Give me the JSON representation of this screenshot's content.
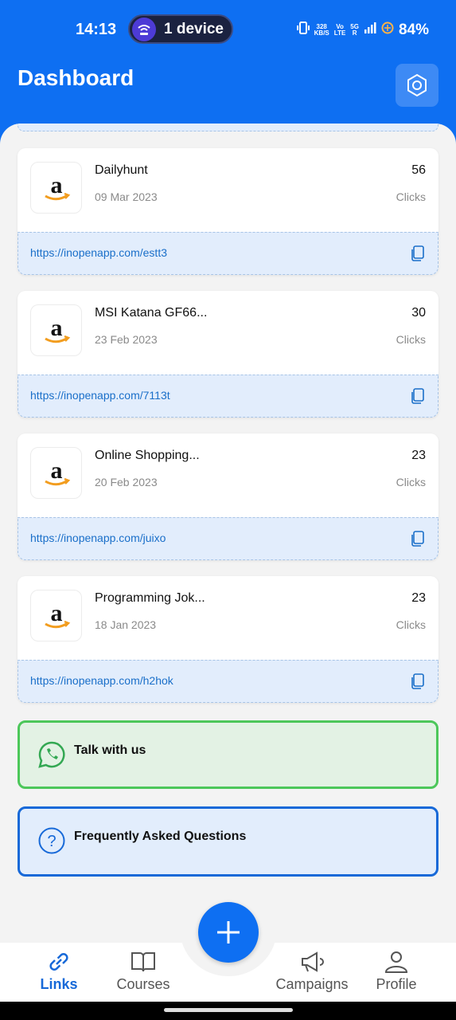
{
  "status": {
    "time": "14:13",
    "pill": "1 device",
    "speed": [
      "328",
      "KB/S"
    ],
    "volte": [
      "Vo",
      "LTE"
    ],
    "net": [
      "5G",
      "R"
    ],
    "battery": "84%"
  },
  "header": {
    "title": "Dashboard"
  },
  "links": [
    {
      "name": "Dailyhunt",
      "date": "09 Mar 2023",
      "clicks": "56",
      "clicks_label": "Clicks",
      "url": "https://inopenapp.com/estt3"
    },
    {
      "name": "MSI Katana GF66...",
      "date": "23 Feb 2023",
      "clicks": "30",
      "clicks_label": "Clicks",
      "url": "https://inopenapp.com/7113t"
    },
    {
      "name": "Online Shopping...",
      "date": "20 Feb 2023",
      "clicks": "23",
      "clicks_label": "Clicks",
      "url": "https://inopenapp.com/juixo"
    },
    {
      "name": "Programming Jok...",
      "date": "18 Jan 2023",
      "clicks": "23",
      "clicks_label": "Clicks",
      "url": "https://inopenapp.com/h2hok"
    }
  ],
  "support": {
    "talk": "Talk with us",
    "faq": "Frequently Asked Questions"
  },
  "nav": {
    "links": "Links",
    "courses": "Courses",
    "campaigns": "Campaigns",
    "profile": "Profile"
  },
  "colors": {
    "primary": "#0e6ff2",
    "whatsapp": "#4cc75a",
    "link_bg": "#e2edfc",
    "link_text": "#1a6fc9"
  },
  "icons": {
    "logo": "amazon-logo-icon",
    "copy": "copy-icon",
    "settings": "settings-icon"
  }
}
